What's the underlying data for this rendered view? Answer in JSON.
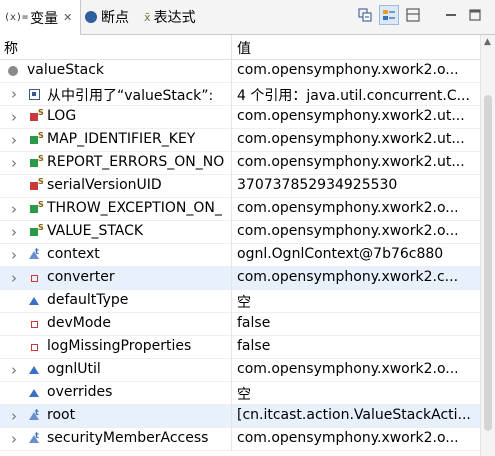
{
  "tabs": {
    "variables": {
      "icon": "(x)=",
      "label": "变量",
      "close": "✕"
    },
    "breakpoints": {
      "label": "断点"
    },
    "expressions": {
      "icon": "x̄",
      "label": "表达式"
    }
  },
  "toolbar_icons": [
    "collapse-icon",
    "show-type-names-icon",
    "layout-icon",
    "minimize-icon",
    "maximize-icon"
  ],
  "columns": {
    "name": "称",
    "value": "值"
  },
  "colors": {
    "selection": "#e8f1fb",
    "field_private": "#c83a3a",
    "field_default": "#3a6fc4"
  },
  "rows": [
    {
      "name": "valueStack",
      "value": "com.opensymphony.xwork2.o..."
    },
    {
      "name": "从中引用了“valueStack”:",
      "value": "4 个引用：java.util.concurrent.C..."
    },
    {
      "name": "LOG",
      "value": "com.opensymphony.xwork2.ut..."
    },
    {
      "name": "MAP_IDENTIFIER_KEY",
      "value": "com.opensymphony.xwork2.ut..."
    },
    {
      "name": "REPORT_ERRORS_ON_NO",
      "value": "com.opensymphony.xwork2.ut..."
    },
    {
      "name": "serialVersionUID",
      "value": "370737852934925530"
    },
    {
      "name": "THROW_EXCEPTION_ON_",
      "value": "com.opensymphony.xwork2.o..."
    },
    {
      "name": "VALUE_STACK",
      "value": "com.opensymphony.xwork2.o..."
    },
    {
      "name": "context",
      "value": "ognl.OgnlContext@7b76c880"
    },
    {
      "name": "converter",
      "value": "com.opensymphony.xwork2.c..."
    },
    {
      "name": "defaultType",
      "value": "空"
    },
    {
      "name": "devMode",
      "value": "false"
    },
    {
      "name": "logMissingProperties",
      "value": "false"
    },
    {
      "name": "ognlUtil",
      "value": "com.opensymphony.xwork2.o..."
    },
    {
      "name": "overrides",
      "value": "空"
    },
    {
      "name": "root",
      "value": "[cn.itcast.action.ValueStackActi..."
    },
    {
      "name": "securityMemberAccess",
      "value": "com.opensymphony.xwork2.o..."
    }
  ]
}
